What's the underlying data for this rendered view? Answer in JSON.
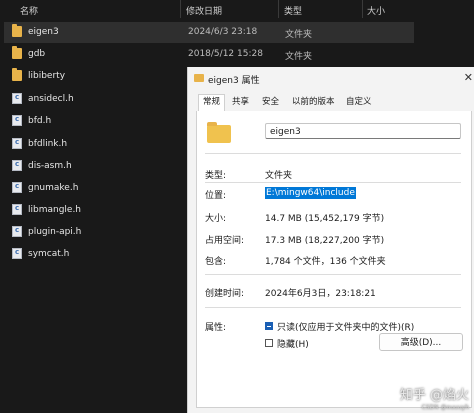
{
  "columns": {
    "name": "名称",
    "date": "修改日期",
    "type": "类型",
    "size": "大小"
  },
  "rows": [
    {
      "name": "eigen3",
      "date": "2024/6/3 23:18",
      "type": "文件夹",
      "icon": "folder-icon"
    },
    {
      "name": "gdb",
      "date": "2018/5/12 15:28",
      "type": "文件夹",
      "icon": "folder-icon"
    },
    {
      "name": "libiberty",
      "icon": "folder-icon"
    },
    {
      "name": "ansidecl.h",
      "icon": "c-header-file-icon"
    },
    {
      "name": "bfd.h",
      "icon": "c-header-file-icon"
    },
    {
      "name": "bfdlink.h",
      "icon": "c-header-file-icon"
    },
    {
      "name": "dis-asm.h",
      "icon": "c-header-file-icon"
    },
    {
      "name": "gnumake.h",
      "icon": "c-header-file-icon"
    },
    {
      "name": "libmangle.h",
      "icon": "c-header-file-icon"
    },
    {
      "name": "plugin-api.h",
      "icon": "c-header-file-icon"
    },
    {
      "name": "symcat.h",
      "icon": "c-header-file-icon"
    }
  ],
  "dialog": {
    "title": "eigen3 属性",
    "close": "✕",
    "tabs": [
      "常规",
      "共享",
      "安全",
      "以前的版本",
      "自定义"
    ],
    "folder_name": "eigen3",
    "props": {
      "type_label": "类型:",
      "type_value": "文件夹",
      "location_label": "位置:",
      "location_value": "E:\\mingw64\\include",
      "size_label": "大小:",
      "size_value": "14.7 MB (15,452,179 字节)",
      "disk_label": "占用空间:",
      "disk_value": "17.3 MB (18,227,200 字节)",
      "contains_label": "包含:",
      "contains_value": "1,784 个文件，136 个文件夹",
      "created_label": "创建时间:",
      "created_value": "2024年6月3日，23:18:21",
      "attr_label": "属性:",
      "readonly_label": "只读(仅应用于文件夹中的文件)(R)",
      "hidden_label": "隐藏(H)",
      "advanced_button": "高级(D)..."
    }
  },
  "watermark": "知乎 @焰火",
  "watermark_small": "CSDN @ouuuyh"
}
